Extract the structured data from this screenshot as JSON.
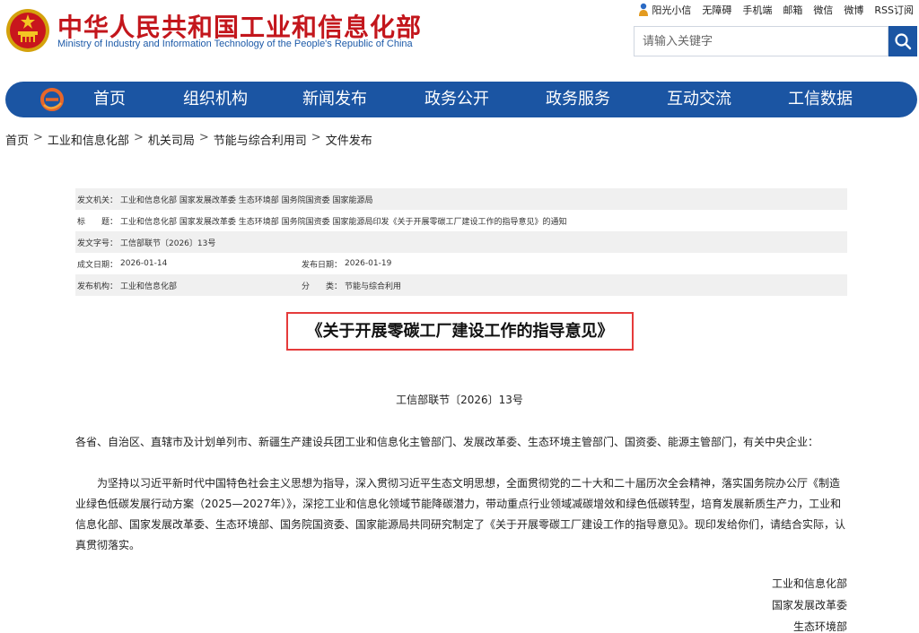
{
  "header": {
    "title_cn": "中华人民共和国工业和信息化部",
    "title_en": "Ministry of Industry and Information Technology of the People's Republic of China",
    "top_links": [
      "阳光小信",
      "无障碍",
      "手机端",
      "邮箱",
      "微信",
      "微博",
      "RSS订阅"
    ],
    "search_placeholder": "请输入关键字"
  },
  "nav": {
    "items": [
      "首页",
      "组织机构",
      "新闻发布",
      "政务公开",
      "政务服务",
      "互动交流",
      "工信数据"
    ]
  },
  "breadcrumb": [
    "首页",
    "工业和信息化部",
    "机关司局",
    "节能与综合利用司",
    "文件发布"
  ],
  "meta": {
    "issuer_label": "发文机关：",
    "issuer": "工业和信息化部 国家发展改革委 生态环境部 国务院国资委 国家能源局",
    "title_label": "标　　题：",
    "title": "工业和信息化部 国家发展改革委 生态环境部 国务院国资委 国家能源局印发《关于开展零碳工厂建设工作的指导意见》的通知",
    "doc_no_label": "发文字号：",
    "doc_no": "工信部联节〔2026〕13号",
    "created_label": "成文日期：",
    "created": "2026-01-14",
    "published_label": "发布日期：",
    "published": "2026-01-19",
    "org_label": "发布机构：",
    "org": "工业和信息化部",
    "category_label": "分　　类：",
    "category": "节能与综合利用"
  },
  "document": {
    "title": "《关于开展零碳工厂建设工作的指导意见》",
    "number": "工信部联节〔2026〕13号",
    "addressee": "各省、自治区、直辖市及计划单列市、新疆生产建设兵团工业和信息化主管部门、发展改革委、生态环境主管部门、国资委、能源主管部门，有关中央企业：",
    "paragraph": "为坚持以习近平新时代中国特色社会主义思想为指导，深入贯彻习近平生态文明思想，全面贯彻党的二十大和二十届历次全会精神，落实国务院办公厅《制造业绿色低碳发展行动方案（2025—2027年）》，深挖工业和信息化领域节能降碳潜力，带动重点行业领域减碳增效和绿色低碳转型，培育发展新质生产力，工业和信息化部、国家发展改革委、生态环境部、国务院国资委、国家能源局共同研究制定了《关于开展零碳工厂建设工作的指导意见》。现印发给你们，请结合实际，认真贯彻落实。",
    "signers": [
      "工业和信息化部",
      "国家发展改革委",
      "生态环境部"
    ]
  },
  "colors": {
    "brand_red": "#c3161c",
    "nav_blue": "#1b55a3",
    "highlight_red": "#e53b3b"
  }
}
